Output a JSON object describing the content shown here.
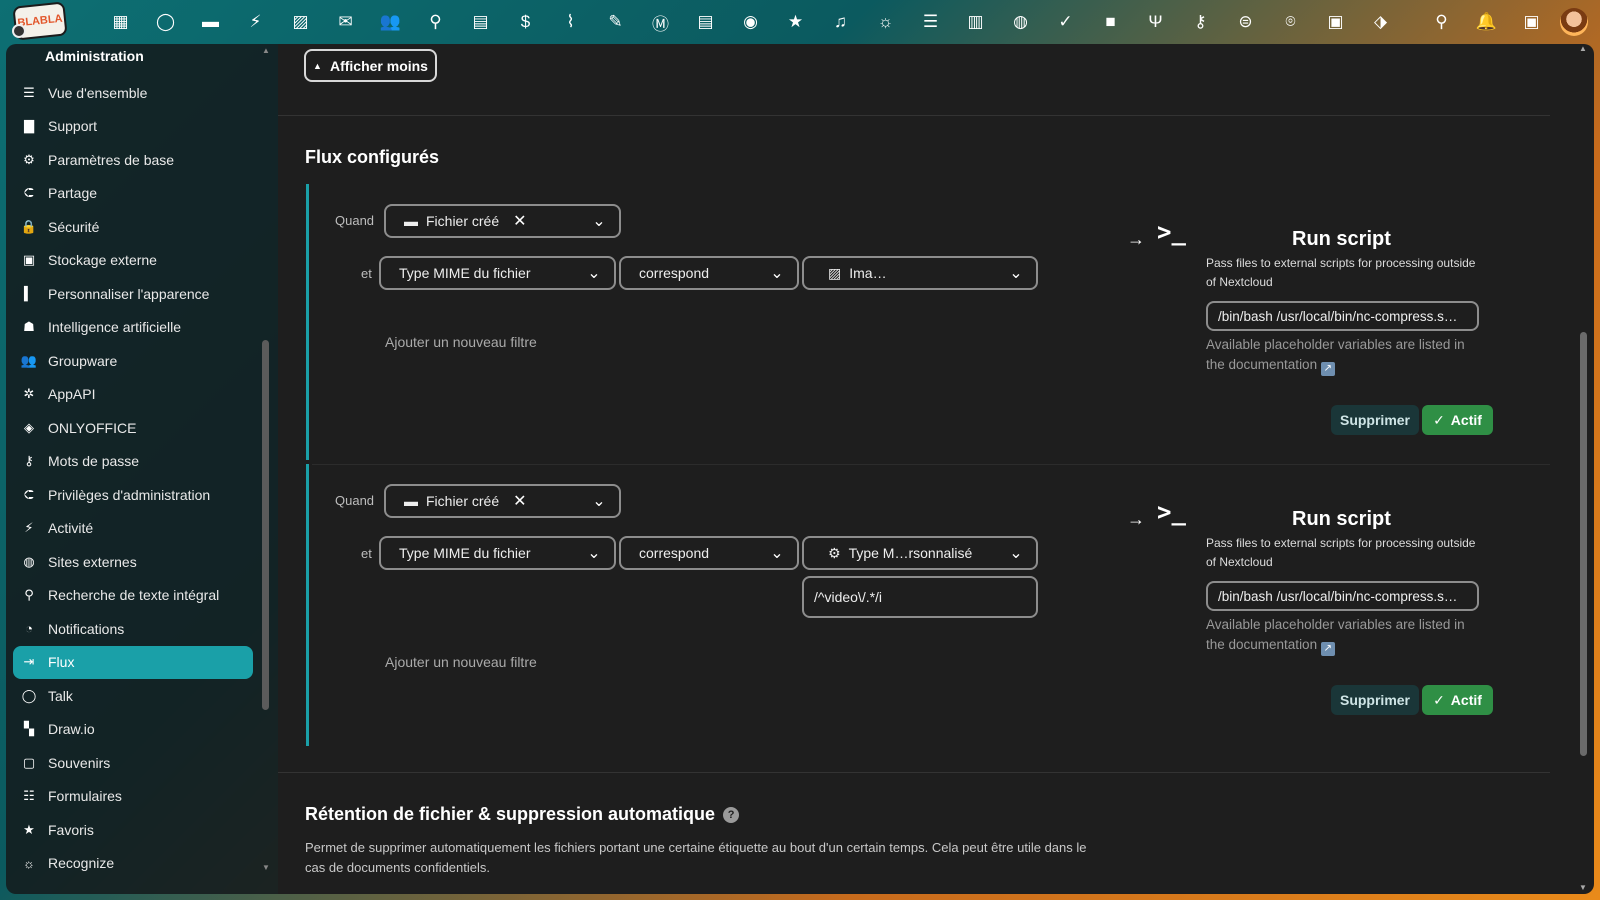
{
  "topbar": {
    "logo_text": "BLABLA",
    "apps": [
      "dashboard-icon",
      "talk-icon",
      "files-icon",
      "activity-icon",
      "photos-icon",
      "mail-icon",
      "contacts-icon",
      "search-icon",
      "calendar-icon",
      "money-icon",
      "cleanup-icon",
      "notes-icon",
      "mastodon-icon",
      "deck-icon",
      "github-icon",
      "favorites-icon",
      "music-icon",
      "recognize-icon",
      "tasks-icon",
      "analytics-icon",
      "web-icon",
      "check-icon",
      "video-icon",
      "cookbook-icon",
      "passwords-icon",
      "integration-icon",
      "maps-icon",
      "memories-icon",
      "tickets-icon"
    ],
    "right": [
      "unified-search-icon",
      "notifications-icon",
      "contacts-menu-icon"
    ]
  },
  "sidebar": {
    "title": "Administration",
    "items": [
      {
        "label": "Vue d'ensemble",
        "icon": "overview-icon",
        "glyph": "☰"
      },
      {
        "label": "Support",
        "icon": "support-icon",
        "glyph": "▇"
      },
      {
        "label": "Paramètres de base",
        "icon": "settings-icon",
        "glyph": "⚙"
      },
      {
        "label": "Partage",
        "icon": "share-icon",
        "glyph": "⮈"
      },
      {
        "label": "Sécurité",
        "icon": "lock-icon",
        "glyph": "🔒"
      },
      {
        "label": "Stockage externe",
        "icon": "storage-icon",
        "glyph": "▣"
      },
      {
        "label": "Personnaliser l'apparence",
        "icon": "paint-icon",
        "glyph": "▍"
      },
      {
        "label": "Intelligence artificielle",
        "icon": "ai-icon",
        "glyph": "☗"
      },
      {
        "label": "Groupware",
        "icon": "groupware-icon",
        "glyph": "👥"
      },
      {
        "label": "AppAPI",
        "icon": "appapi-icon",
        "glyph": "✲"
      },
      {
        "label": "ONLYOFFICE",
        "icon": "layers-icon",
        "glyph": "◈"
      },
      {
        "label": "Mots de passe",
        "icon": "key-icon",
        "glyph": "⚷"
      },
      {
        "label": "Privilèges d'administration",
        "icon": "admin-icon",
        "glyph": "⮈"
      },
      {
        "label": "Activité",
        "icon": "activity-icon",
        "glyph": "⚡"
      },
      {
        "label": "Sites externes",
        "icon": "globe-icon",
        "glyph": "◍"
      },
      {
        "label": "Recherche de texte intégral",
        "icon": "search-icon",
        "glyph": "⚲"
      },
      {
        "label": "Notifications",
        "icon": "bell-icon",
        "glyph": "◔"
      },
      {
        "label": "Flux",
        "icon": "flow-icon",
        "glyph": "⇥",
        "active": true
      },
      {
        "label": "Talk",
        "icon": "talk-icon",
        "glyph": "◯"
      },
      {
        "label": "Draw.io",
        "icon": "drawio-icon",
        "glyph": "▚"
      },
      {
        "label": "Souvenirs",
        "icon": "memories-icon",
        "glyph": "▢"
      },
      {
        "label": "Formulaires",
        "icon": "forms-icon",
        "glyph": "☷"
      },
      {
        "label": "Favoris",
        "icon": "star-icon",
        "glyph": "★"
      },
      {
        "label": "Recognize",
        "icon": "recognize-icon",
        "glyph": "☼"
      },
      {
        "label": "…",
        "icon": "more-icon",
        "glyph": "•"
      }
    ]
  },
  "main": {
    "show_less_label": "Afficher moins",
    "flows_title": "Flux configurés",
    "flows": [
      {
        "when_label": "Quand",
        "trigger": "Fichier créé",
        "and_label": "et",
        "check_field": "Type MIME du fichier",
        "operator": "correspond",
        "value": "Ima…",
        "value_icon": "image-icon",
        "custom_value": null,
        "add_filter": "Ajouter un nouveau filtre",
        "op_title": "Run script",
        "op_desc": "Pass files to external scripts for processing outside of Nextcloud",
        "op_input": "/bin/bash /usr/local/bin/nc-compress.s…",
        "op_note": "Available placeholder variables are listed in the documentation",
        "delete_label": "Supprimer",
        "active_label": "Actif"
      },
      {
        "when_label": "Quand",
        "trigger": "Fichier créé",
        "and_label": "et",
        "check_field": "Type MIME du fichier",
        "operator": "correspond",
        "value": "Type M…rsonnalisé",
        "value_icon": "gear-icon",
        "custom_value": "/^video\\/.*/i",
        "add_filter": "Ajouter un nouveau filtre",
        "op_title": "Run script",
        "op_desc": "Pass files to external scripts for processing outside of Nextcloud",
        "op_input": "/bin/bash /usr/local/bin/nc-compress.s…",
        "op_note": "Available placeholder variables are listed in the documentation",
        "delete_label": "Supprimer",
        "active_label": "Actif"
      }
    ],
    "retention_title": "Rétention de fichier & suppression automatique",
    "retention_desc": "Permet de supprimer automatiquement les fichiers portant une certaine étiquette au bout d'un certain temps. Cela peut être utile dans le cas de documents confidentiels."
  }
}
